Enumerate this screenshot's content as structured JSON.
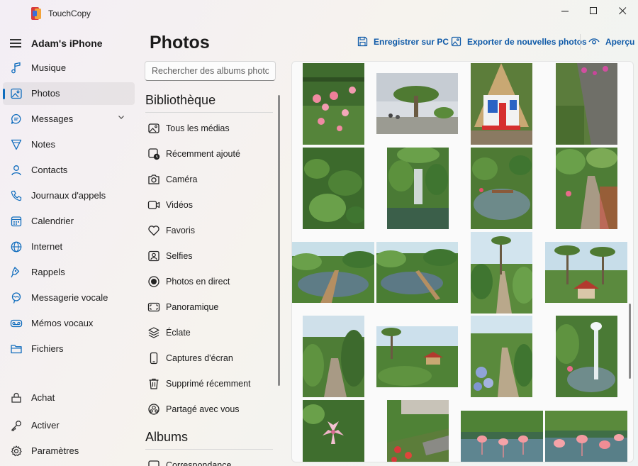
{
  "app": {
    "title": "TouchCopy"
  },
  "window_controls": {
    "minimize": "—",
    "maximize": "☐",
    "close": "✕"
  },
  "sidebar": {
    "device_name": "Adam's iPhone",
    "items": [
      {
        "label": "Musique",
        "icon": "music-icon"
      },
      {
        "label": "Photos",
        "icon": "photos-icon",
        "active": true
      },
      {
        "label": "Messages",
        "icon": "messages-icon",
        "expandable": true
      },
      {
        "label": "Notes",
        "icon": "notes-icon"
      },
      {
        "label": "Contacts",
        "icon": "contacts-icon"
      },
      {
        "label": "Journaux d'appels",
        "icon": "phone-icon"
      },
      {
        "label": "Calendrier",
        "icon": "calendar-icon"
      },
      {
        "label": "Internet",
        "icon": "globe-icon"
      },
      {
        "label": "Rappels",
        "icon": "reminders-icon"
      },
      {
        "label": "Messagerie vocale",
        "icon": "voicemail-icon"
      },
      {
        "label": "Mémos vocaux",
        "icon": "voice-memo-icon"
      },
      {
        "label": "Fichiers",
        "icon": "folder-icon"
      }
    ],
    "bottom_items": [
      {
        "label": "Achat",
        "icon": "cart-icon"
      },
      {
        "label": "Activer",
        "icon": "key-icon"
      },
      {
        "label": "Paramètres",
        "icon": "gear-icon"
      }
    ]
  },
  "main": {
    "title": "Photos",
    "actions": {
      "save_pc": "Enregistrer sur PC",
      "export_new": "Exporter de nouvelles photos",
      "preview": "Aperçu"
    }
  },
  "albums_panel": {
    "search_placeholder": "Rechercher des albums photo",
    "library_title": "Bibliothèque",
    "library_items": [
      {
        "label": "Tous les médias",
        "icon": "all-media-icon"
      },
      {
        "label": "Récemment ajouté",
        "icon": "recently-added-icon"
      },
      {
        "label": "Caméra",
        "icon": "camera-icon"
      },
      {
        "label": "Vidéos",
        "icon": "video-icon"
      },
      {
        "label": "Favoris",
        "icon": "heart-icon"
      },
      {
        "label": "Selfies",
        "icon": "selfie-icon"
      },
      {
        "label": "Photos en direct",
        "icon": "live-photo-icon"
      },
      {
        "label": "Panoramique",
        "icon": "panorama-icon"
      },
      {
        "label": "Éclate",
        "icon": "burst-icon"
      },
      {
        "label": "Captures d'écran",
        "icon": "screenshot-icon"
      },
      {
        "label": "Supprimé récemment",
        "icon": "trash-icon"
      },
      {
        "label": "Partagé avec vous",
        "icon": "shared-icon"
      }
    ],
    "albums_title": "Albums",
    "albums_items": [
      {
        "label": "Correspondance",
        "icon": "album-icon"
      }
    ]
  },
  "photos": [
    {
      "scene": "pink-flowers"
    },
    {
      "scene": "dragon-tree"
    },
    {
      "scene": "thatched-house"
    },
    {
      "scene": "garden-wall"
    },
    {
      "scene": "ferns"
    },
    {
      "scene": "waterfall"
    },
    {
      "scene": "pond-garden"
    },
    {
      "scene": "garden-path"
    },
    {
      "scene": "pond-bridge"
    },
    {
      "scene": "pond-bridge-2"
    },
    {
      "scene": "palm-path"
    },
    {
      "scene": "gazebo"
    },
    {
      "scene": "hedge-path"
    },
    {
      "scene": "red-pagoda"
    },
    {
      "scene": "hydrangea-path"
    },
    {
      "scene": "fountain"
    },
    {
      "scene": "lily"
    },
    {
      "scene": "red-flowers-path"
    },
    {
      "scene": "flamingos"
    },
    {
      "scene": "flamingos-2"
    }
  ],
  "colors": {
    "accent": "#0f6cbd",
    "action_text": "#0f5aa8"
  }
}
